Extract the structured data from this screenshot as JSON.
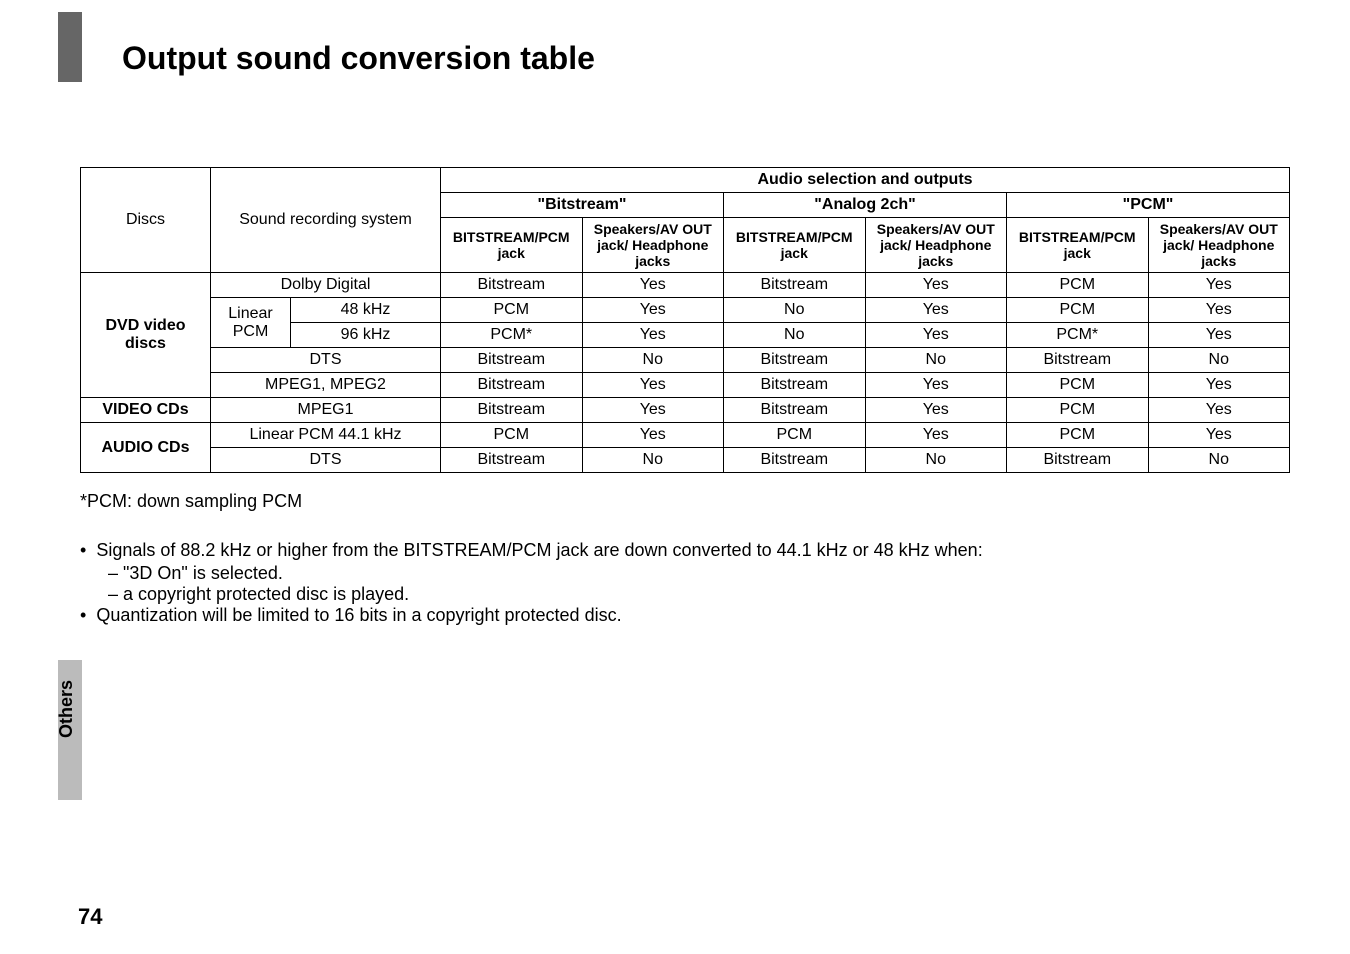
{
  "title": "Output sound conversion table",
  "headers": {
    "discs": "Discs",
    "srs": "Sound recording system",
    "audio_sel": "Audio selection and outputs",
    "modes": [
      "\"Bitstream\"",
      "\"Analog 2ch\"",
      "\"PCM\""
    ],
    "sub1": "BITSTREAM/PCM jack",
    "sub2": "Speakers/AV OUT jack/ Headphone jacks"
  },
  "rows": {
    "dvd_label": "DVD video discs",
    "video_label": "VIDEO CDs",
    "audio_label": "AUDIO CDs",
    "dolby": "Dolby Digital",
    "linear_pcm": "Linear PCM",
    "k48": "48 kHz",
    "k96": "96 kHz",
    "dts": "DTS",
    "mpeg12": "MPEG1, MPEG2",
    "mpeg1": "MPEG1",
    "lpcm441": "Linear PCM 44.1 kHz",
    "dts2": "DTS"
  },
  "data": {
    "dolby": [
      "Bitstream",
      "Yes",
      "Bitstream",
      "Yes",
      "PCM",
      "Yes"
    ],
    "k48": [
      "PCM",
      "Yes",
      "No",
      "Yes",
      "PCM",
      "Yes"
    ],
    "k96": [
      "PCM*",
      "Yes",
      "No",
      "Yes",
      "PCM*",
      "Yes"
    ],
    "dts": [
      "Bitstream",
      "No",
      "Bitstream",
      "No",
      "Bitstream",
      "No"
    ],
    "mpeg12": [
      "Bitstream",
      "Yes",
      "Bitstream",
      "Yes",
      "PCM",
      "Yes"
    ],
    "mpeg1": [
      "Bitstream",
      "Yes",
      "Bitstream",
      "Yes",
      "PCM",
      "Yes"
    ],
    "lpcm441": [
      "PCM",
      "Yes",
      "PCM",
      "Yes",
      "PCM",
      "Yes"
    ],
    "dts2": [
      "Bitstream",
      "No",
      "Bitstream",
      "No",
      "Bitstream",
      "No"
    ]
  },
  "footnote": "*PCM: down sampling PCM",
  "bullets": {
    "b1": "Signals of 88.2 kHz or higher from the BITSTREAM/PCM jack are down converted to 44.1 kHz or 48 kHz when:",
    "s1": "– \"3D On\" is selected.",
    "s2": "– a copyright protected disc is played.",
    "b2": "Quantization will be limited to 16 bits in a copyright protected disc."
  },
  "side_label": "Others",
  "page_number": "74"
}
